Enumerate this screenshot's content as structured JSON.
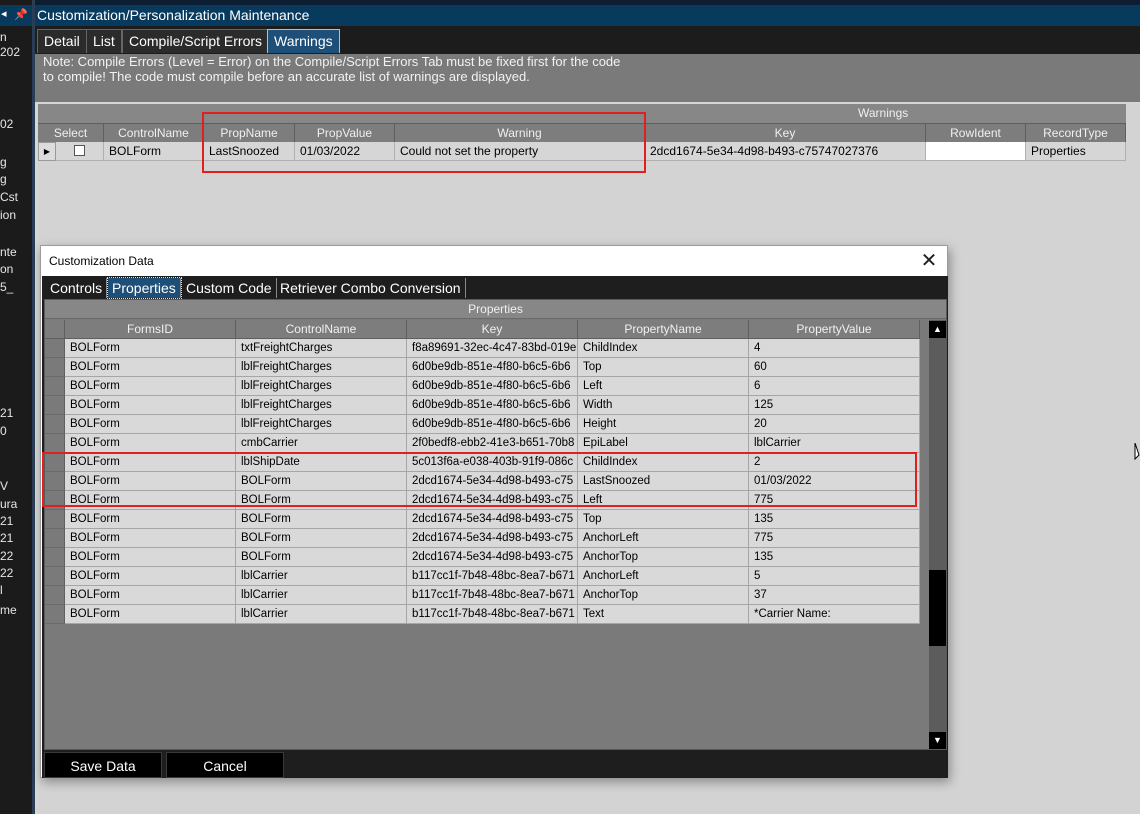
{
  "window": {
    "title": "Customization/Personalization Maintenance"
  },
  "left_sidebar": {
    "fragments": [
      "n",
      "202",
      "02",
      "g",
      "g",
      "Cst",
      "ion",
      "nte",
      "on",
      "5_",
      "21",
      "0",
      "V",
      "ura",
      "21",
      "21",
      "22",
      "22",
      "l",
      "me"
    ]
  },
  "tabs": [
    {
      "label": "Detail",
      "active": false
    },
    {
      "label": "List",
      "active": false
    },
    {
      "label": "Compile/Script Errors",
      "active": false
    },
    {
      "label": "Warnings",
      "active": true
    }
  ],
  "note": {
    "line1": "Note: Compile Errors (Level = Error) on the Compile/Script Errors Tab  must be fixed first for the code",
    "line2": "to compile!  The code must compile before an accurate list of warnings are displayed."
  },
  "warnings_grid": {
    "title": "Warnings",
    "columns": [
      "Select",
      "ControlName",
      "PropName",
      "PropValue",
      "Warning",
      "Key",
      "RowIdent",
      "RecordType"
    ],
    "rows": [
      {
        "select": false,
        "control_name": "BOLForm",
        "prop_name": "LastSnoozed",
        "prop_value": "01/03/2022",
        "warning": "Could not set the property",
        "key": "2dcd1674-5e34-4d98-b493-c75747027376",
        "row_ident": "",
        "record_type": "Properties"
      }
    ]
  },
  "dialog": {
    "title": "Customization Data",
    "tabs": [
      {
        "label": "Controls",
        "active": false
      },
      {
        "label": "Properties",
        "active": true
      },
      {
        "label": "Custom Code",
        "active": false
      },
      {
        "label": "Retriever Combo Conversion",
        "active": false
      }
    ],
    "properties_title": "Properties",
    "columns": [
      "FormsID",
      "ControlName",
      "Key",
      "PropertyName",
      "PropertyValue"
    ],
    "rows": [
      [
        "BOLForm",
        "txtFreightCharges",
        "f8a89691-32ec-4c47-83bd-019e",
        "ChildIndex",
        "4"
      ],
      [
        "BOLForm",
        "lblFreightCharges",
        "6d0be9db-851e-4f80-b6c5-6b6",
        "Top",
        "60"
      ],
      [
        "BOLForm",
        "lblFreightCharges",
        "6d0be9db-851e-4f80-b6c5-6b6",
        "Left",
        "6"
      ],
      [
        "BOLForm",
        "lblFreightCharges",
        "6d0be9db-851e-4f80-b6c5-6b6",
        "Width",
        "125"
      ],
      [
        "BOLForm",
        "lblFreightCharges",
        "6d0be9db-851e-4f80-b6c5-6b6",
        "Height",
        "20"
      ],
      [
        "BOLForm",
        "cmbCarrier",
        "2f0bedf8-ebb2-41e3-b651-70b8",
        "EpiLabel",
        "lblCarrier"
      ],
      [
        "BOLForm",
        "lblShipDate",
        "5c013f6a-e038-403b-91f9-086c",
        "ChildIndex",
        "2"
      ],
      [
        "BOLForm",
        "BOLForm",
        "2dcd1674-5e34-4d98-b493-c75",
        "LastSnoozed",
        "01/03/2022"
      ],
      [
        "BOLForm",
        "BOLForm",
        "2dcd1674-5e34-4d98-b493-c75",
        "Left",
        "775"
      ],
      [
        "BOLForm",
        "BOLForm",
        "2dcd1674-5e34-4d98-b493-c75",
        "Top",
        "135"
      ],
      [
        "BOLForm",
        "BOLForm",
        "2dcd1674-5e34-4d98-b493-c75",
        "AnchorLeft",
        "775"
      ],
      [
        "BOLForm",
        "BOLForm",
        "2dcd1674-5e34-4d98-b493-c75",
        "AnchorTop",
        "135"
      ],
      [
        "BOLForm",
        "lblCarrier",
        "b117cc1f-7b48-48bc-8ea7-b671",
        "AnchorLeft",
        "5"
      ],
      [
        "BOLForm",
        "lblCarrier",
        "b117cc1f-7b48-48bc-8ea7-b671",
        "AnchorTop",
        "37"
      ],
      [
        "BOLForm",
        "lblCarrier",
        "b117cc1f-7b48-48bc-8ea7-b671",
        "Text",
        "*Carrier Name:"
      ]
    ],
    "save_label": "Save Data",
    "cancel_label": "Cancel",
    "close_icon": "close-icon"
  },
  "colors": {
    "title_bar": "#083a5e",
    "active_tab": "#1e4f78",
    "highlight_box": "#e02020"
  }
}
